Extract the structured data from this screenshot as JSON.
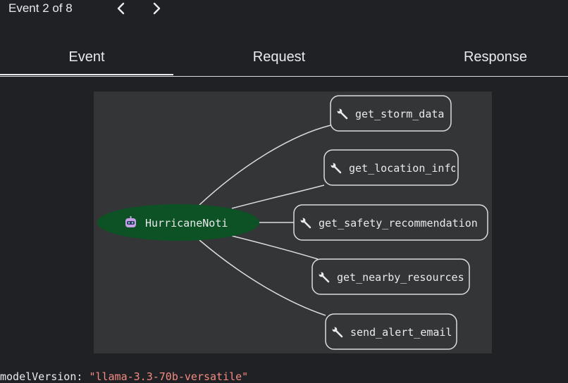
{
  "header": {
    "event_counter": "Event 2 of 8",
    "prev_icon": "chevron-left-icon",
    "next_icon": "chevron-right-icon"
  },
  "tabs": [
    {
      "label": "Event",
      "active": true
    },
    {
      "label": "Request",
      "active": false
    },
    {
      "label": "Response",
      "active": false
    }
  ],
  "graph": {
    "agent": {
      "label": "HurricaneNoti",
      "icon": "robot-icon",
      "color": "#0d5224"
    },
    "tools": [
      {
        "label": "get_storm_data",
        "icon": "wrench-icon"
      },
      {
        "label": "get_location_info",
        "icon": "wrench-icon"
      },
      {
        "label": "get_safety_recommendation",
        "icon": "wrench-icon"
      },
      {
        "label": "get_nearby_resources",
        "icon": "wrench-icon"
      },
      {
        "label": "send_alert_email",
        "icon": "wrench-icon"
      }
    ],
    "colors": {
      "panel": "#333537",
      "edge": "#dadce0",
      "tool_border": "#dadce0"
    }
  },
  "code": {
    "key": "modelVersion:",
    "value": "\"llama-3.3-70b-versatile\""
  }
}
